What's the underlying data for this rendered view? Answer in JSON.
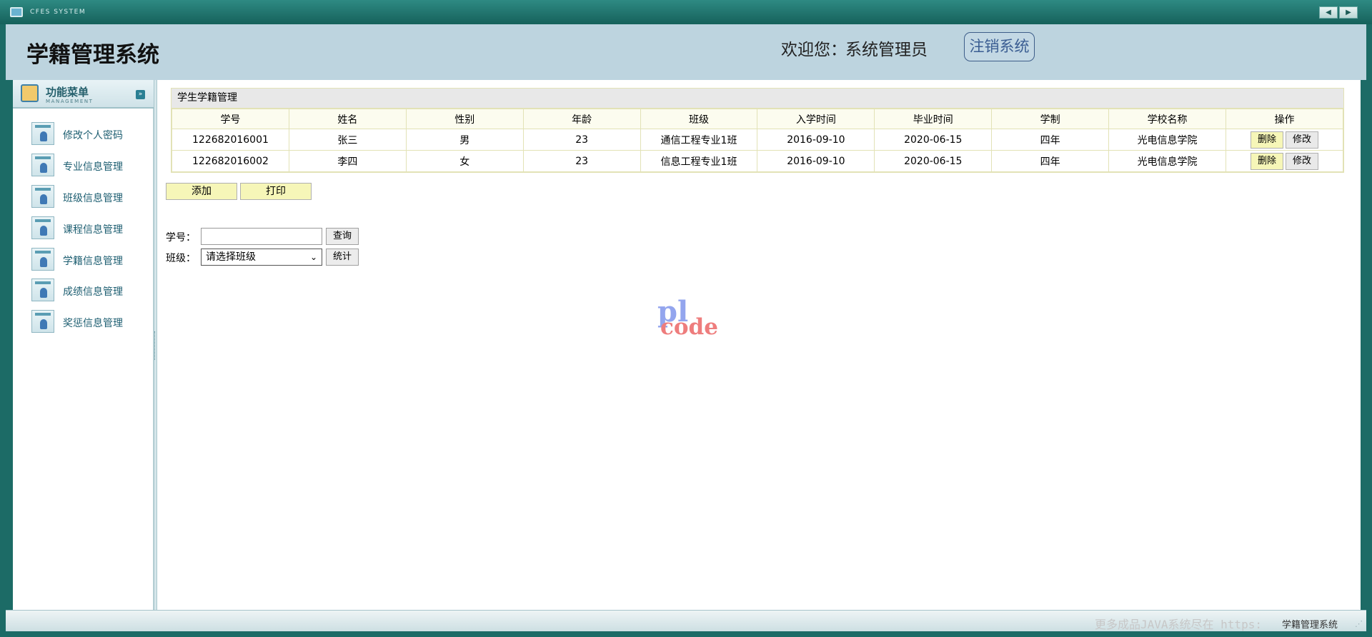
{
  "window": {
    "system_name": "CFES SYSTEM",
    "nav_prev": "◀",
    "nav_next": "▶"
  },
  "header": {
    "title": "学籍管理系统",
    "welcome_label": "欢迎您：",
    "user_name": "系统管理员",
    "logout_label": "注销系统"
  },
  "sidebar": {
    "menu_title": "功能菜单",
    "menu_subtitle": "MANAGEMENT",
    "toggle_icon": "double-chevron-down-icon",
    "items": [
      {
        "label": "修改个人密码"
      },
      {
        "label": "专业信息管理"
      },
      {
        "label": "班级信息管理"
      },
      {
        "label": "课程信息管理"
      },
      {
        "label": "学籍信息管理"
      },
      {
        "label": "成绩信息管理"
      },
      {
        "label": "奖惩信息管理"
      }
    ]
  },
  "panel": {
    "title": "学生学籍管理",
    "columns": [
      "学号",
      "姓名",
      "性别",
      "年龄",
      "班级",
      "入学时间",
      "毕业时间",
      "学制",
      "学校名称",
      "操作"
    ],
    "rows": [
      {
        "id": "122682016001",
        "name": "张三",
        "gender": "男",
        "age": "23",
        "class": "通信工程专业1班",
        "enroll": "2016-09-10",
        "graduate": "2020-06-15",
        "length": "四年",
        "school": "光电信息学院"
      },
      {
        "id": "122682016002",
        "name": "李四",
        "gender": "女",
        "age": "23",
        "class": "信息工程专业1班",
        "enroll": "2016-09-10",
        "graduate": "2020-06-15",
        "length": "四年",
        "school": "光电信息学院"
      }
    ],
    "delete_label": "删除",
    "edit_label": "修改"
  },
  "actions": {
    "add_label": "添加",
    "print_label": "打印"
  },
  "query": {
    "id_label": "学号：",
    "id_value": "",
    "search_label": "查询",
    "class_label": "班级：",
    "class_selected": "请选择班级",
    "stat_label": "统计"
  },
  "watermark": {
    "line1": "pl",
    "line2": "code"
  },
  "footer": {
    "ad_text": "更多成品JAVA系统尽在 https:",
    "app_name": "学籍管理系统",
    "resize_glyph": "⋰"
  }
}
